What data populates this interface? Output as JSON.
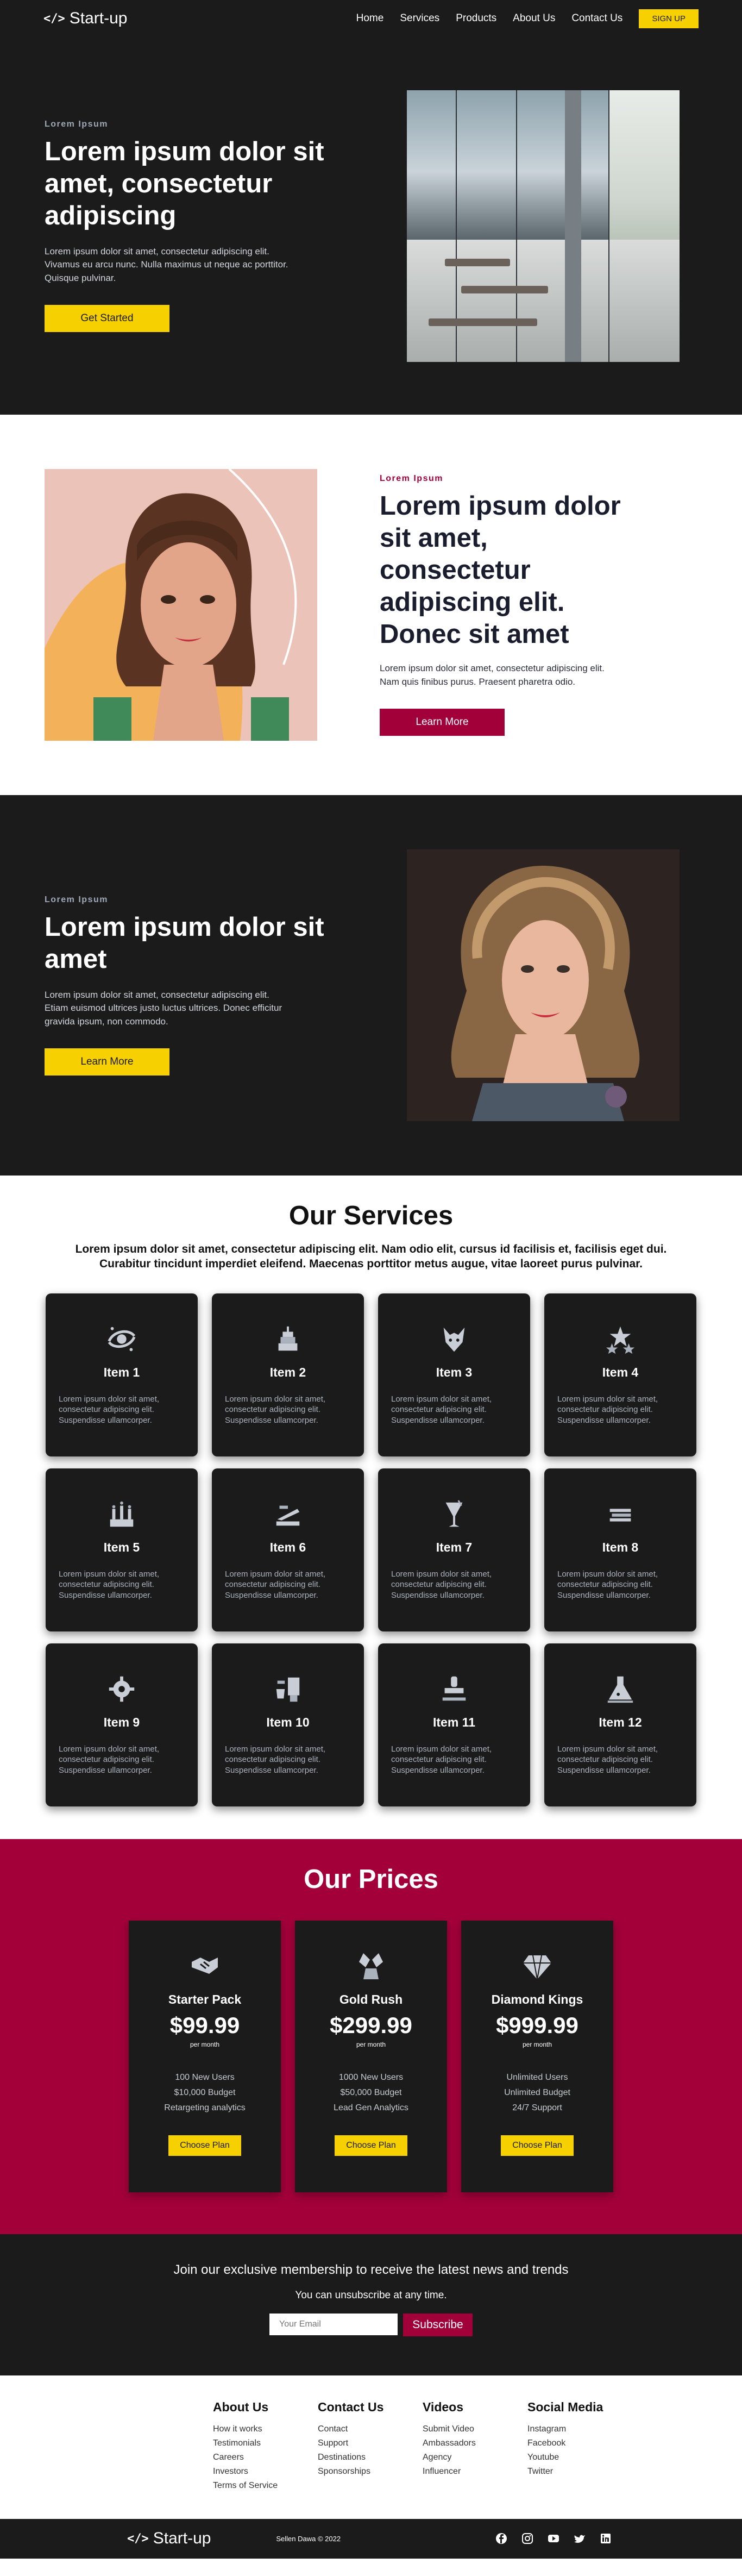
{
  "nav": {
    "logo_icon": "</>",
    "logo_text": "Start-up",
    "links": [
      "Home",
      "Services",
      "Products",
      "About Us",
      "Contact Us"
    ],
    "signup": "SIGN UP"
  },
  "hero": {
    "eyebrow": "Lorem Ipsum",
    "title": "Lorem ipsum dolor sit amet, consectetur adipiscing",
    "text": "Lorem ipsum dolor sit amet, consectetur adipiscing elit. Vivamus eu arcu nunc. Nulla maximus ut neque ac porttitor. Quisque pulvinar.",
    "button": "Get Started"
  },
  "about": {
    "eyebrow": "Lorem Ipsum",
    "title": "Lorem ipsum dolor sit amet, consectetur adipiscing elit. Donec sit amet",
    "text": "Lorem ipsum dolor sit amet, consectetur adipiscing elit. Nam quis finibus purus. Praesent pharetra odio.",
    "button": "Learn More"
  },
  "feature": {
    "eyebrow": "Lorem Ipsum",
    "title": "Lorem ipsum dolor sit amet",
    "text": "Lorem ipsum dolor sit amet, consectetur adipiscing elit. Etiam euismod ultrices justo luctus ultrices. Donec efficitur gravida ipsum, non commodo.",
    "button": "Learn More"
  },
  "services": {
    "title": "Our Services",
    "lead": "Lorem ipsum dolor sit amet, consectetur adipiscing elit. Nam odio elit, cursus id facilisis et, facilisis eget dui. Curabitur tincidunt imperdiet eleifend. Maecenas porttitor metus augue, vitae laoreet purus pulvinar.",
    "items": [
      {
        "title": "Item 1",
        "text": "Lorem ipsum dolor sit amet, consectetur adipiscing elit. Suspendisse ullamcorper.",
        "icon": "galaxy-icon"
      },
      {
        "title": "Item 2",
        "text": "Lorem ipsum dolor sit amet, consectetur adipiscing elit. Suspendisse ullamcorper.",
        "icon": "cake-icon"
      },
      {
        "title": "Item 3",
        "text": "Lorem ipsum dolor sit amet, consectetur adipiscing elit. Suspendisse ullamcorper.",
        "icon": "wolf-head-icon"
      },
      {
        "title": "Item 4",
        "text": "Lorem ipsum dolor sit amet, consectetur adipiscing elit. Suspendisse ullamcorper.",
        "icon": "stars-icon"
      },
      {
        "title": "Item 5",
        "text": "Lorem ipsum dolor sit amet, consectetur adipiscing elit. Suspendisse ullamcorper.",
        "icon": "candles-icon"
      },
      {
        "title": "Item 6",
        "text": "Lorem ipsum dolor sit amet, consectetur adipiscing elit. Suspendisse ullamcorper.",
        "icon": "stapler-icon"
      },
      {
        "title": "Item 7",
        "text": "Lorem ipsum dolor sit amet, consectetur adipiscing elit. Suspendisse ullamcorper.",
        "icon": "drink-icon"
      },
      {
        "title": "Item 8",
        "text": "Lorem ipsum dolor sit amet, consectetur adipiscing elit. Suspendisse ullamcorper.",
        "icon": "stack-icon"
      },
      {
        "title": "Item 9",
        "text": "Lorem ipsum dolor sit amet, consectetur adipiscing elit. Suspendisse ullamcorper.",
        "icon": "gear-spiral-icon"
      },
      {
        "title": "Item 10",
        "text": "Lorem ipsum dolor sit amet, consectetur adipiscing elit. Suspendisse ullamcorper.",
        "icon": "blender-icon"
      },
      {
        "title": "Item 11",
        "text": "Lorem ipsum dolor sit amet, consectetur adipiscing elit. Suspendisse ullamcorper.",
        "icon": "stamp-icon"
      },
      {
        "title": "Item 12",
        "text": "Lorem ipsum dolor sit amet, consectetur adipiscing elit. Suspendisse ullamcorper.",
        "icon": "flask-icon"
      }
    ]
  },
  "prices": {
    "title": "Our Prices",
    "plans": [
      {
        "name": "Starter Pack",
        "price": "$99.99",
        "per": "per month",
        "features": [
          "100 New Users",
          "$10,000 Budget",
          "Retargeting analytics"
        ],
        "button": "Choose Plan",
        "icon": "handshake-icon"
      },
      {
        "name": "Gold Rush",
        "price": "$299.99",
        "per": "per month",
        "features": [
          "1000 New Users",
          "$50,000 Budget",
          "Lead Gen Analytics"
        ],
        "button": "Choose Plan",
        "icon": "nugget-icon"
      },
      {
        "name": "Diamond Kings",
        "price": "$999.99",
        "per": "per month",
        "features": [
          "Unlimited Users",
          "Unlimited Budget",
          "24/7 Support"
        ],
        "button": "Choose Plan",
        "icon": "diamond-icon"
      }
    ]
  },
  "newsletter": {
    "title": "Join our exclusive membership to receive the latest news and trends",
    "subtitle": "You can unsubscribe at any time.",
    "placeholder": "Your Email",
    "button": "Subscribe"
  },
  "footer": {
    "columns": [
      {
        "title": "About Us",
        "links": [
          "How it works",
          "Testimonials",
          "Careers",
          "Investors",
          "Terms of Service"
        ]
      },
      {
        "title": "Contact Us",
        "links": [
          "Contact",
          "Support",
          "Destinations",
          "Sponsorships"
        ]
      },
      {
        "title": "Videos",
        "links": [
          "Submit Video",
          "Ambassadors",
          "Agency",
          "Influencer"
        ]
      },
      {
        "title": "Social Media",
        "links": [
          "Instagram",
          "Facebook",
          "Youtube",
          "Twitter"
        ]
      }
    ],
    "logo_icon": "</>",
    "logo_text": "Start-up",
    "copyright": "Sellen Dawa © 2022",
    "socials": [
      "facebook-icon",
      "instagram-icon",
      "youtube-icon",
      "twitter-icon",
      "linkedin-icon"
    ]
  },
  "colors": {
    "dark": "#1b1b1b",
    "gold": "#f7d000",
    "crimson": "#a20039"
  }
}
